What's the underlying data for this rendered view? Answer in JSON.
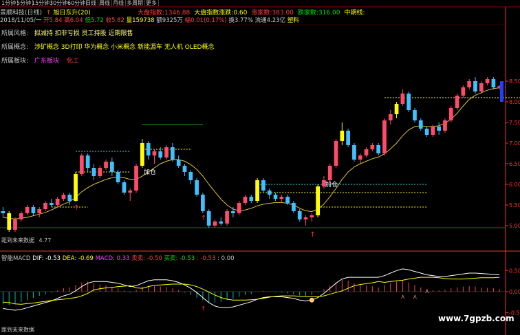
{
  "tabs": [
    "1分钟",
    "5分钟",
    "15分钟",
    "30分钟",
    "60分钟",
    "日线",
    "周线",
    "月线",
    "多周期",
    "更多"
  ],
  "header": {
    "name": "景顺科技(日线)",
    "arrow": "↑",
    "indicator": "旭日东升(20)",
    "stats": [
      {
        "label": "大盘指数:",
        "value": "1346.88",
        "color": "#ff4040"
      },
      {
        "label": "大盘指数涨跌:",
        "value": "0.60",
        "color": "#ffff00"
      },
      {
        "label": "涨家数:",
        "value": "383.00",
        "color": "#ff4040"
      },
      {
        "label": "跌家数:",
        "value": "316.00",
        "color": "#00e000"
      },
      {
        "label": "中期线:",
        "value": "",
        "color": "#ffff00"
      }
    ],
    "info_line": [
      {
        "t": "2018/11/05/一",
        "c": "#c8c8c8"
      },
      {
        "t": " 开5.84",
        "c": "#ff4040"
      },
      {
        "t": " 高6.04",
        "c": "#ff4040"
      },
      {
        "t": " 低5.72",
        "c": "#00e000"
      },
      {
        "t": " 收5.82",
        "c": "#ff4040"
      },
      {
        "t": " 量159738",
        "c": "#ffff00"
      },
      {
        "t": " 额9325万",
        "c": "#c8c8c8"
      },
      {
        "t": " 幅0.01(0.17%)",
        "c": "#ff4040"
      },
      {
        "t": " 换3.77%",
        "c": "#c8c8c8"
      },
      {
        "t": " 流通4.23亿",
        "c": "#c8c8c8"
      },
      {
        "t": " 塑料",
        "c": "#ffff00"
      }
    ],
    "rows": [
      {
        "label": "所属风格:",
        "text": "拟减持 扣非亏损 员工持股 近期限售",
        "color": "#ffff80"
      },
      {
        "label": "所属概念:",
        "text": "涉矿概念 3D打印 华为概念 小米概念 新能源车 无人机 OLED概念",
        "color": "#ffff00"
      },
      {
        "label": "所属板块:",
        "text": "广东板块",
        "color": "#ff40ff",
        "text2": "化工",
        "color2": "#ff4040"
      }
    ]
  },
  "annotations": {
    "bottom_label": "距到未来数据",
    "min_price": "4.77",
    "callout": "加仓",
    "callout2": "加仓",
    "buy_marks": [
      "↑",
      "↑",
      "↑"
    ]
  },
  "macd_header": [
    {
      "t": "智能MACD",
      "c": "#c8c8c8"
    },
    {
      "t": " DIF: -0.53",
      "c": "#ffffff"
    },
    {
      "t": " DEA: -0.69",
      "c": "#ffff00"
    },
    {
      "t": " MACD: 0.33",
      "c": "#ff40ff"
    },
    {
      "t": " 卖卖: -0.50",
      "c": "#ff4040"
    },
    {
      "t": " 买卖: ",
      "c": "#00e000"
    },
    {
      "t": " -0.53",
      "c": "#00e000"
    },
    {
      "t": " : -0.53",
      "c": "#ff4040"
    },
    {
      "t": " : 0.00",
      "c": "#c8c8c8"
    }
  ],
  "macd_bottom_label": "距到未来数据",
  "watermark": "www.7gpzb.com",
  "colors": {
    "up": "#ff4a6a",
    "down": "#40c0ff",
    "yellow": "#ffff00",
    "grid": "#8b0000",
    "axis": "#ff3030"
  },
  "chart_data": {
    "type": "candlestick",
    "price_axis": {
      "ticks": [
        "8.50",
        "8.00",
        "7.50",
        "7.00",
        "6.50",
        "6.00",
        "5.50",
        "5.00"
      ],
      "range": [
        4.6,
        8.6
      ]
    },
    "macd_axis": {
      "ticks": [
        "0.50",
        "0.00",
        "-0.50"
      ],
      "range": [
        -0.75,
        0.75
      ]
    },
    "candles": [
      [
        5.35,
        5.45,
        5.2,
        5.3
      ],
      [
        5.3,
        5.35,
        4.85,
        4.9
      ],
      [
        4.9,
        5.2,
        4.85,
        5.15
      ],
      [
        5.15,
        5.35,
        5.1,
        5.3
      ],
      [
        5.3,
        5.5,
        5.25,
        5.45
      ],
      [
        5.45,
        5.5,
        5.25,
        5.3
      ],
      [
        5.3,
        5.45,
        5.2,
        5.4
      ],
      [
        5.4,
        5.6,
        5.35,
        5.55
      ],
      [
        5.55,
        5.65,
        5.45,
        5.5
      ],
      [
        5.5,
        5.7,
        5.45,
        5.65
      ],
      [
        5.65,
        5.8,
        5.6,
        5.75
      ],
      [
        5.75,
        5.8,
        5.5,
        5.6
      ],
      [
        5.6,
        6.3,
        5.58,
        6.25
      ],
      [
        6.25,
        6.75,
        6.2,
        6.7
      ],
      [
        6.7,
        6.75,
        6.3,
        6.4
      ],
      [
        6.4,
        6.5,
        6.1,
        6.2
      ],
      [
        6.2,
        6.45,
        6.15,
        6.4
      ],
      [
        6.4,
        6.6,
        6.35,
        6.55
      ],
      [
        6.55,
        6.65,
        6.2,
        6.3
      ],
      [
        6.3,
        6.35,
        6.0,
        6.05
      ],
      [
        6.05,
        6.1,
        5.75,
        5.8
      ],
      [
        5.8,
        5.9,
        5.6,
        5.85
      ],
      [
        5.85,
        6.5,
        5.8,
        6.45
      ],
      [
        6.45,
        7.1,
        6.4,
        7.0
      ],
      [
        7.0,
        7.05,
        6.6,
        6.7
      ],
      [
        6.7,
        6.85,
        6.5,
        6.8
      ],
      [
        6.8,
        6.9,
        6.6,
        6.65
      ],
      [
        6.65,
        6.95,
        6.6,
        6.9
      ],
      [
        6.9,
        7.0,
        6.55,
        6.6
      ],
      [
        6.6,
        6.7,
        6.4,
        6.45
      ],
      [
        6.45,
        6.5,
        6.2,
        6.3
      ],
      [
        6.3,
        6.35,
        6.0,
        6.1
      ],
      [
        6.1,
        6.15,
        5.7,
        5.75
      ],
      [
        5.75,
        5.8,
        5.3,
        5.35
      ],
      [
        5.35,
        5.4,
        4.95,
        5.0
      ],
      [
        5.0,
        5.15,
        4.95,
        5.1
      ],
      [
        5.1,
        5.2,
        5.0,
        5.05
      ],
      [
        5.05,
        5.4,
        5.0,
        5.35
      ],
      [
        5.35,
        5.45,
        5.2,
        5.3
      ],
      [
        5.3,
        5.6,
        5.25,
        5.55
      ],
      [
        5.55,
        5.75,
        5.5,
        5.7
      ],
      [
        5.7,
        5.75,
        5.55,
        5.6
      ],
      [
        5.6,
        6.15,
        5.55,
        6.1
      ],
      [
        6.1,
        6.15,
        5.8,
        5.85
      ],
      [
        5.85,
        5.9,
        5.65,
        5.75
      ],
      [
        5.75,
        5.8,
        5.6,
        5.65
      ],
      [
        5.65,
        5.75,
        5.55,
        5.7
      ],
      [
        5.7,
        5.75,
        5.5,
        5.55
      ],
      [
        5.55,
        5.6,
        5.3,
        5.35
      ],
      [
        5.35,
        5.4,
        5.1,
        5.15
      ],
      [
        5.15,
        5.25,
        5.0,
        5.2
      ],
      [
        5.2,
        5.3,
        5.1,
        5.25
      ],
      [
        5.25,
        6.0,
        5.2,
        5.95
      ],
      [
        5.95,
        6.2,
        5.9,
        6.1
      ],
      [
        6.1,
        6.5,
        6.05,
        6.45
      ],
      [
        6.45,
        7.1,
        6.4,
        7.05
      ],
      [
        7.05,
        7.5,
        6.95,
        7.3
      ],
      [
        7.3,
        7.35,
        6.9,
        6.95
      ],
      [
        6.95,
        7.0,
        6.55,
        6.6
      ],
      [
        6.6,
        6.75,
        6.5,
        6.7
      ],
      [
        6.7,
        6.9,
        6.65,
        6.85
      ],
      [
        6.85,
        7.0,
        6.8,
        6.95
      ],
      [
        6.95,
        7.0,
        6.7,
        6.75
      ],
      [
        6.75,
        7.6,
        6.7,
        7.55
      ],
      [
        7.55,
        7.8,
        7.45,
        7.7
      ],
      [
        7.7,
        8.0,
        7.6,
        7.95
      ],
      [
        7.95,
        8.3,
        7.9,
        8.2
      ],
      [
        8.2,
        8.25,
        7.75,
        7.8
      ],
      [
        7.8,
        7.85,
        7.5,
        7.55
      ],
      [
        7.55,
        7.6,
        7.3,
        7.35
      ],
      [
        7.35,
        7.4,
        7.15,
        7.2
      ],
      [
        7.2,
        7.45,
        7.15,
        7.4
      ],
      [
        7.4,
        7.5,
        7.2,
        7.3
      ],
      [
        7.3,
        7.6,
        7.25,
        7.55
      ],
      [
        7.55,
        7.9,
        7.5,
        7.85
      ],
      [
        7.85,
        8.2,
        7.8,
        8.15
      ],
      [
        8.15,
        8.4,
        8.1,
        8.35
      ],
      [
        8.35,
        8.55,
        8.3,
        8.5
      ],
      [
        8.5,
        8.6,
        8.2,
        8.25
      ],
      [
        8.25,
        8.5,
        8.2,
        8.45
      ],
      [
        8.45,
        8.6,
        8.4,
        8.55
      ],
      [
        8.55,
        8.6,
        8.3,
        8.35
      ],
      [
        8.35,
        8.4,
        8.3,
        8.38
      ]
    ],
    "yellow_bars": [
      1,
      12,
      23,
      42,
      52,
      56,
      65
    ],
    "ma_line": [
      5.2,
      5.18,
      5.16,
      5.18,
      5.2,
      5.24,
      5.28,
      5.32,
      5.38,
      5.45,
      5.52,
      5.58,
      5.68,
      5.82,
      5.92,
      6.0,
      6.06,
      6.12,
      6.16,
      6.18,
      6.16,
      6.12,
      6.12,
      6.2,
      6.3,
      6.4,
      6.5,
      6.56,
      6.6,
      6.6,
      6.56,
      6.48,
      6.36,
      6.2,
      6.0,
      5.82,
      5.64,
      5.5,
      5.4,
      5.36,
      5.38,
      5.42,
      5.48,
      5.52,
      5.54,
      5.56,
      5.56,
      5.54,
      5.5,
      5.42,
      5.36,
      5.34,
      5.4,
      5.52,
      5.7,
      5.9,
      6.12,
      6.3,
      6.42,
      6.5,
      6.56,
      6.62,
      6.66,
      6.74,
      6.86,
      7.0,
      7.18,
      7.32,
      7.4,
      7.42,
      7.4,
      7.4,
      7.42,
      7.48,
      7.58,
      7.72,
      7.9,
      8.06,
      8.16,
      8.22,
      8.28,
      8.32,
      8.34
    ],
    "macd_hist": [
      -0.3,
      -0.32,
      -0.3,
      -0.25,
      -0.2,
      -0.15,
      -0.1,
      -0.06,
      -0.02,
      0.03,
      0.08,
      0.1,
      0.16,
      0.22,
      0.24,
      0.2,
      0.17,
      0.15,
      0.12,
      0.08,
      0.03,
      -0.02,
      0.05,
      0.12,
      0.14,
      0.13,
      0.12,
      0.11,
      0.08,
      0.04,
      -0.02,
      -0.08,
      -0.14,
      -0.2,
      -0.25,
      -0.26,
      -0.24,
      -0.2,
      -0.16,
      -0.12,
      -0.08,
      -0.05,
      0.0,
      0.02,
      0.01,
      -0.01,
      -0.02,
      -0.04,
      -0.06,
      -0.09,
      -0.1,
      -0.08,
      -0.02,
      0.06,
      0.14,
      0.22,
      0.28,
      0.26,
      0.2,
      0.17,
      0.15,
      0.13,
      0.1,
      0.16,
      0.2,
      0.24,
      0.27,
      0.22,
      0.16,
      0.1,
      0.06,
      0.04,
      0.03,
      0.05,
      0.08,
      0.1,
      0.12,
      0.13,
      0.12,
      0.1,
      0.09,
      0.08,
      0.06
    ],
    "dif": [
      -0.4,
      -0.42,
      -0.44,
      -0.42,
      -0.38,
      -0.34,
      -0.3,
      -0.26,
      -0.22,
      -0.16,
      -0.1,
      -0.06,
      0.02,
      0.12,
      0.2,
      0.24,
      0.24,
      0.24,
      0.22,
      0.2,
      0.16,
      0.12,
      0.14,
      0.2,
      0.26,
      0.28,
      0.28,
      0.28,
      0.26,
      0.22,
      0.16,
      0.08,
      -0.02,
      -0.14,
      -0.26,
      -0.34,
      -0.38,
      -0.38,
      -0.36,
      -0.32,
      -0.28,
      -0.24,
      -0.18,
      -0.14,
      -0.12,
      -0.12,
      -0.12,
      -0.14,
      -0.16,
      -0.2,
      -0.22,
      -0.2,
      -0.14,
      -0.04,
      0.08,
      0.2,
      0.3,
      0.34,
      0.34,
      0.34,
      0.34,
      0.34,
      0.34,
      0.38,
      0.44,
      0.5,
      0.54,
      0.52,
      0.48,
      0.44,
      0.4,
      0.38,
      0.36,
      0.36,
      0.38,
      0.4,
      0.42,
      0.44,
      0.44,
      0.43,
      0.42,
      0.41,
      0.4
    ],
    "dea": [
      -0.25,
      -0.26,
      -0.29,
      -0.3,
      -0.28,
      -0.27,
      -0.25,
      -0.23,
      -0.21,
      -0.19,
      -0.18,
      -0.16,
      -0.14,
      -0.1,
      -0.04,
      0.04,
      0.07,
      0.09,
      0.1,
      0.12,
      0.13,
      0.14,
      0.09,
      0.08,
      0.12,
      0.15,
      0.16,
      0.17,
      0.18,
      0.18,
      0.18,
      0.16,
      0.12,
      0.06,
      -0.01,
      -0.08,
      -0.14,
      -0.18,
      -0.2,
      -0.2,
      -0.2,
      -0.19,
      -0.18,
      -0.16,
      -0.13,
      -0.11,
      -0.1,
      -0.1,
      -0.1,
      -0.11,
      -0.12,
      -0.12,
      -0.12,
      -0.1,
      -0.06,
      -0.02,
      0.02,
      0.08,
      0.14,
      0.17,
      0.19,
      0.21,
      0.24,
      0.22,
      0.24,
      0.26,
      0.27,
      0.3,
      0.32,
      0.34,
      0.34,
      0.34,
      0.33,
      0.31,
      0.3,
      0.3,
      0.3,
      0.31,
      0.32,
      0.33,
      0.33,
      0.33,
      0.34
    ]
  }
}
